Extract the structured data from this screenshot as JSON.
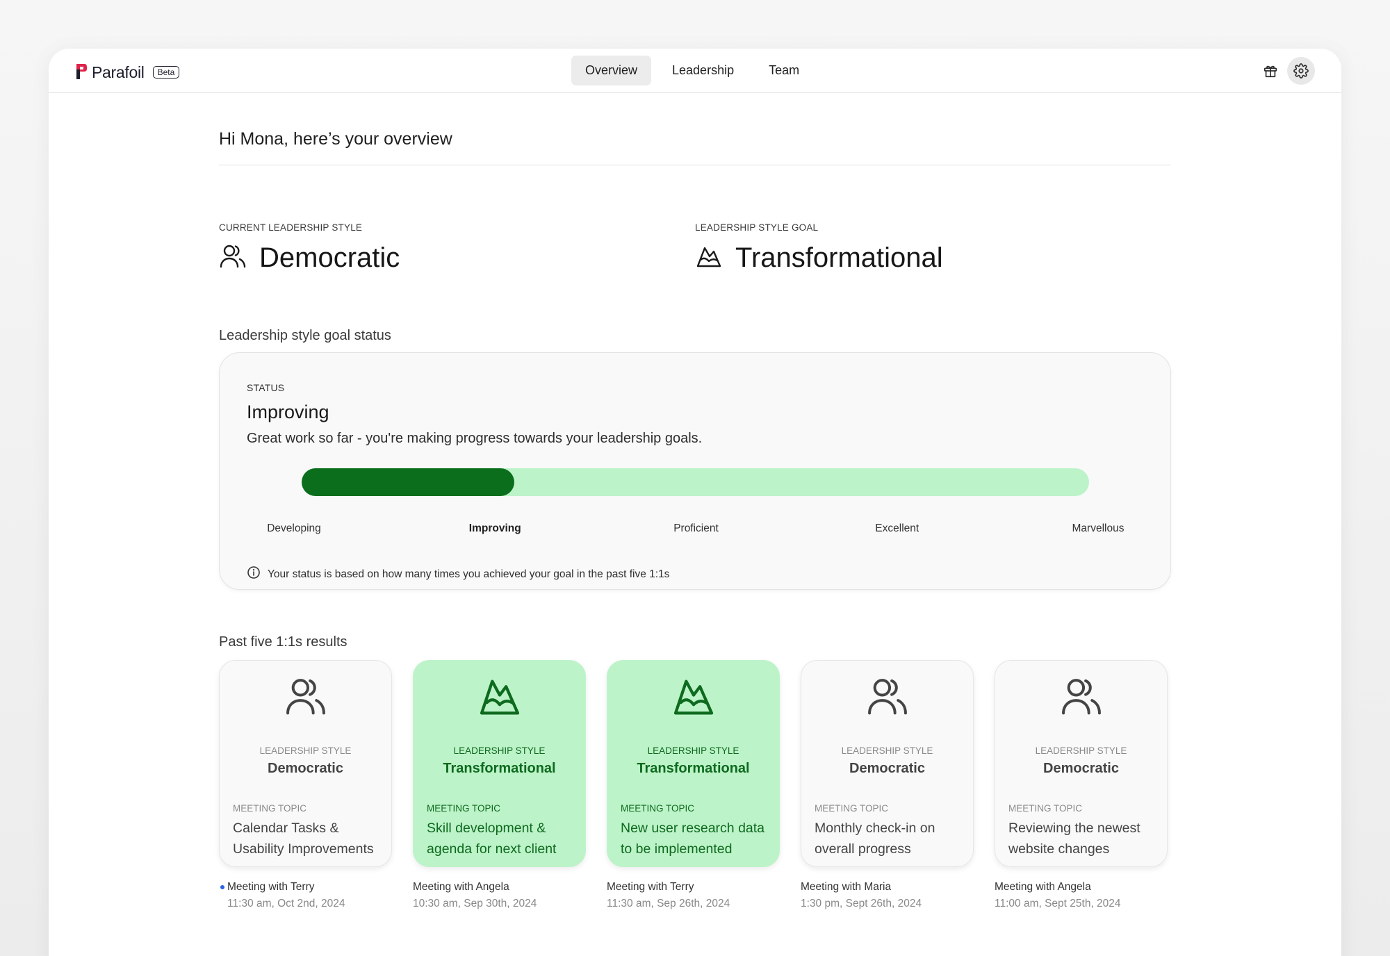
{
  "brand": {
    "name": "Parafoil",
    "badge": "Beta"
  },
  "nav": {
    "tabs": [
      {
        "label": "Overview",
        "active": true
      },
      {
        "label": "Leadership"
      },
      {
        "label": "Team"
      }
    ]
  },
  "header": {
    "icons": [
      "gift-icon",
      "gear-icon"
    ]
  },
  "greeting": "Hi Mona, here’s your overview",
  "current_style": {
    "label": "CURRENT LEADERSHIP STYLE",
    "value": "Democratic",
    "icon": "people-icon"
  },
  "goal_style": {
    "label": "LEADERSHIP STYLE GOAL",
    "value": "Transformational",
    "icon": "mountain-icon"
  },
  "goal_status": {
    "section_title": "Leadership style goal status",
    "label": "STATUS",
    "status": "Improving",
    "description": "Great work so far - you're making progress towards your leadership goals.",
    "progress_fraction": 0.27,
    "levels": [
      "Developing",
      "Improving",
      "Proficient",
      "Excellent",
      "Marvellous"
    ],
    "current_level": "Improving",
    "note": "Your status is based on how many times you achieved your goal in the past five 1:1s"
  },
  "colors": {
    "accent_green": "#0b6e1d",
    "light_green": "#bdf3c9",
    "dot_blue": "#2b63e6"
  },
  "past": {
    "title": "Past five 1:1s results",
    "style_label": "LEADERSHIP STYLE",
    "topic_label": "MEETING TOPIC",
    "meetings": [
      {
        "style": "Democratic",
        "topic": "Calendar Tasks & Usability Improvements",
        "with": "Meeting with Terry",
        "time": "11:30 am, Oct 2nd, 2024",
        "goal_met": false,
        "unread": true
      },
      {
        "style": "Transformational",
        "topic": "Skill development & agenda for next client",
        "with": "Meeting with Angela",
        "time": "10:30 am, Sep 30th, 2024",
        "goal_met": true
      },
      {
        "style": "Transformational",
        "topic": "New user research data to be implemented",
        "with": "Meeting with Terry",
        "time": "11:30 am, Sep 26th, 2024",
        "goal_met": true
      },
      {
        "style": "Democratic",
        "topic": "Monthly check-in on overall progress",
        "with": "Meeting with Maria",
        "time": "1:30 pm, Sept 26th, 2024",
        "goal_met": false
      },
      {
        "style": "Democratic",
        "topic": "Reviewing the newest website changes",
        "with": "Meeting with Angela",
        "time": "11:00 am, Sept 25th, 2024",
        "goal_met": false
      }
    ]
  }
}
